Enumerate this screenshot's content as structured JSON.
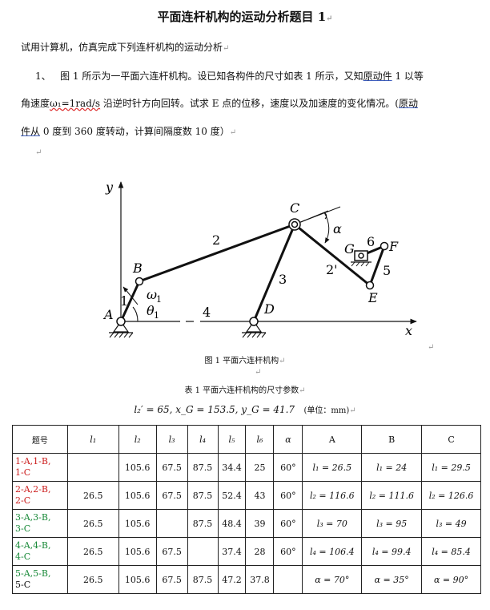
{
  "title": "平面连杆机构的运动分析题目 1",
  "intro": "试用计算机，仿真完成下列连杆机构的运动分析",
  "problem": {
    "num": "1、",
    "p1": "图 1 所示为一平面六连杆机构。设已知各构件的尺寸如表 1 所示，又知",
    "u1": "原动件",
    "p2": " 1 以等",
    "l2a": "角速度",
    "omega": "ω₁",
    "rate": "=1rad/s",
    "l2b": " 沿逆时针方向回转。试求 E 点的位移，速度以及加速度的变化情况。(",
    "u2": "原动",
    "u3": "件从",
    "l3b": " 0 度到 360 度转动，计算间隔度数 10 度）"
  },
  "figure": {
    "caption": "图 1 平面六连杆机构",
    "labels": {
      "y": "y",
      "x": "x",
      "A": "A",
      "B": "B",
      "C": "C",
      "D": "D",
      "E": "E",
      "F": "F",
      "G": "G",
      "n1": "1",
      "n2": "2",
      "n3": "3",
      "n4": "4",
      "n5": "5",
      "n6": "6",
      "n2p": "2'",
      "omega": "ω",
      "omega_sub": "1",
      "theta": "θ",
      "theta_sub": "1",
      "alpha": "α"
    }
  },
  "table": {
    "caption": "表 1 平面六连杆机构的尺寸参数",
    "params": "l₂′ = 65, x_G = 153.5, y_G = 41.7",
    "unit": "(单位：mm)",
    "headers": [
      "题号",
      "l₁",
      "l₂",
      "l₃",
      "l₄",
      "l₅",
      "l₆",
      "α",
      "A",
      "B",
      "C"
    ],
    "rows": [
      {
        "id": [
          "1-A,1-B,",
          "1-C"
        ],
        "color": "red",
        "cells": [
          "",
          "105.6",
          "67.5",
          "87.5",
          "34.4",
          "25",
          "60°",
          "l₁ = 26.5",
          "l₁ = 24",
          "l₁ = 29.5"
        ]
      },
      {
        "id": [
          "2-A,2-B,",
          "2-C"
        ],
        "color": "red",
        "cells": [
          "26.5",
          "105.6",
          "67.5",
          "87.5",
          "52.4",
          "43",
          "60°",
          "l₂ = 116.6",
          "l₂ = 111.6",
          "l₂ = 126.6"
        ]
      },
      {
        "id": [
          "3-A,3-B,",
          "3-C"
        ],
        "color": "green",
        "cells": [
          "26.5",
          "105.6",
          "",
          "87.5",
          "48.4",
          "39",
          "60°",
          "l₃ = 70",
          "l₃ = 95",
          "l₃ = 49"
        ]
      },
      {
        "id": [
          "4-A,4-B,",
          "4-C"
        ],
        "color": "green",
        "cells": [
          "26.5",
          "105.6",
          "67.5",
          "",
          "37.4",
          "28",
          "60°",
          "l₄ = 106.4",
          "l₄ = 99.4",
          "l₄ = 85.4"
        ]
      },
      {
        "id": [
          "5-A,5-B,",
          "5-C"
        ],
        "color": "mixed",
        "cells": [
          "26.5",
          "105.6",
          "67.5",
          "87.5",
          "47.2",
          "37.8",
          "",
          "α = 70°",
          "α = 35°",
          "α = 90°"
        ]
      }
    ]
  }
}
